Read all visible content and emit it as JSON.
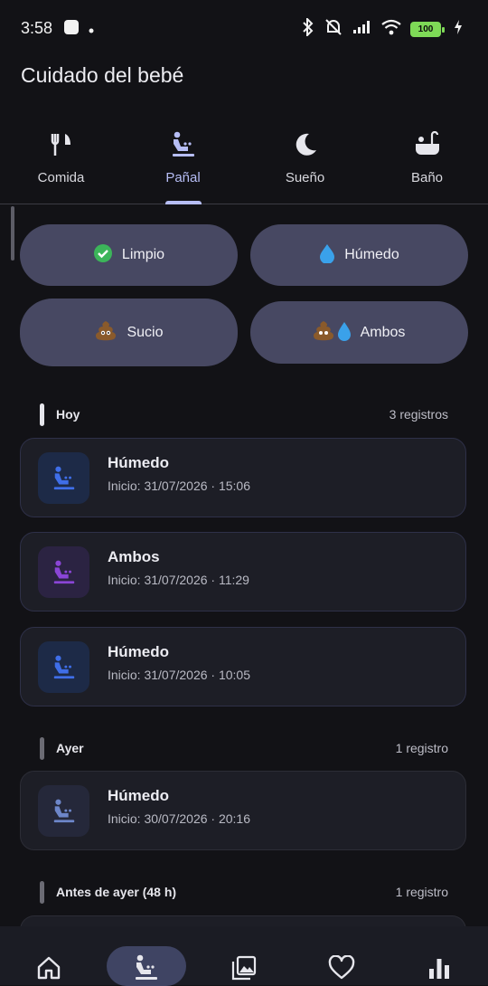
{
  "status": {
    "time": "3:58",
    "battery": "100"
  },
  "app": {
    "title": "Cuidado del bebé"
  },
  "tabs": [
    {
      "label": "Comida",
      "icon": "utensils-icon"
    },
    {
      "label": "Pañal",
      "icon": "diaper-change-icon",
      "active": true
    },
    {
      "label": "Sueño",
      "icon": "moon-icon"
    },
    {
      "label": "Baño",
      "icon": "bathtub-icon"
    }
  ],
  "quick_actions": [
    {
      "label": "Limpio",
      "emoji": "✅"
    },
    {
      "label": "Húmedo",
      "emoji": "💧"
    },
    {
      "label": "Sucio",
      "emoji": "💩"
    },
    {
      "label": "Ambos",
      "emoji": "💩💧"
    }
  ],
  "sections": [
    {
      "title": "Hoy",
      "count": "3 registros"
    },
    {
      "title": "Ayer",
      "count": "1 registro"
    },
    {
      "title": "Antes de ayer (48 h)",
      "count": "1 registro"
    }
  ],
  "entries": [
    {
      "title": "Húmedo",
      "subtitle": "Inicio: 31/07/2026 · 15:06"
    },
    {
      "title": "Ambos",
      "subtitle": "Inicio: 31/07/2026 · 11:29"
    },
    {
      "title": "Húmedo",
      "subtitle": "Inicio: 31/07/2026 · 10:05"
    },
    {
      "title": "Húmedo",
      "subtitle": "Inicio: 30/07/2026 · 20:16"
    }
  ],
  "bottom_nav": [
    {
      "icon": "home-icon"
    },
    {
      "icon": "diaper-change-icon",
      "active": true
    },
    {
      "icon": "gallery-icon"
    },
    {
      "icon": "heart-icon"
    },
    {
      "icon": "bar-chart-icon"
    }
  ],
  "colors": {
    "accent": "#b6bdf5",
    "wet": "#3f6ee8",
    "both": "#8a45d6",
    "card_bg": "#1d1e26",
    "button_bg": "#474862"
  }
}
